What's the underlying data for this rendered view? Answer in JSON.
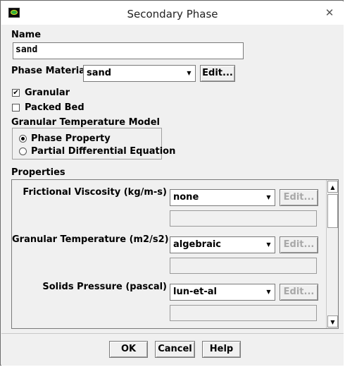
{
  "window": {
    "title": "Secondary Phase"
  },
  "name": {
    "label": "Name",
    "value": "sand"
  },
  "phase_material": {
    "label": "Phase Material",
    "value": "sand",
    "edit_label": "Edit..."
  },
  "granular": {
    "label": "Granular",
    "checked": true,
    "mark": "✔"
  },
  "packed_bed": {
    "label": "Packed Bed",
    "checked": false
  },
  "granular_temp_model": {
    "label": "Granular Temperature Model",
    "options": [
      {
        "label": "Phase Property",
        "selected": true
      },
      {
        "label": "Partial Differential Equation",
        "selected": false
      }
    ]
  },
  "properties": {
    "label": "Properties",
    "rows": [
      {
        "label": "Frictional Viscosity (kg/m-s)",
        "value": "none",
        "edit_label": "Edit..."
      },
      {
        "label": "Granular Temperature (m2/s2)",
        "value": "algebraic",
        "edit_label": "Edit..."
      },
      {
        "label": "Solids Pressure (pascal)",
        "value": "lun-et-al",
        "edit_label": "Edit..."
      }
    ]
  },
  "buttons": {
    "ok": "OK",
    "cancel": "Cancel",
    "help": "Help"
  },
  "icons": {
    "close": "✕",
    "dropdown": "▼",
    "scroll_up": "▲",
    "scroll_down": "▼"
  }
}
